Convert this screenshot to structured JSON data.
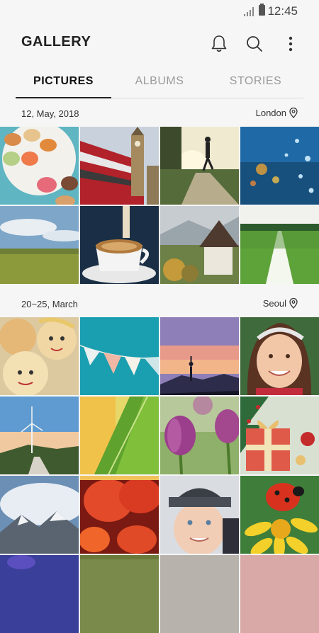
{
  "status_bar": {
    "time": "12:45"
  },
  "app_bar": {
    "title": "GALLERY"
  },
  "tabs": [
    {
      "label": "PICTURES",
      "active": true
    },
    {
      "label": "ALBUMS",
      "active": false
    },
    {
      "label": "STORIES",
      "active": false
    }
  ],
  "sections": [
    {
      "date": "12, May, 2018",
      "location": "London",
      "photos": [
        "macarons",
        "london bus and big ben",
        "runner at sunset",
        "raindrops on glass",
        "wheat field",
        "coffee cup",
        "hillside chapel",
        "football pitch"
      ]
    },
    {
      "date": "20~25, March",
      "location": "Seoul",
      "photos": [
        "decorated cookies",
        "bunting flags",
        "yoga silhouette",
        "smiling girl",
        "wind turbine",
        "green leaf",
        "purple tulips",
        "gift box",
        "snowy mountain",
        "red lanterns",
        "child in knit hat",
        "ladybug on flower",
        "partial photo",
        "partial photo",
        "partial photo",
        "partial photo"
      ]
    }
  ],
  "colors": {
    "background": "#f6f6f6",
    "accent": "#222222",
    "inactive_tab": "#9a9a9a"
  }
}
